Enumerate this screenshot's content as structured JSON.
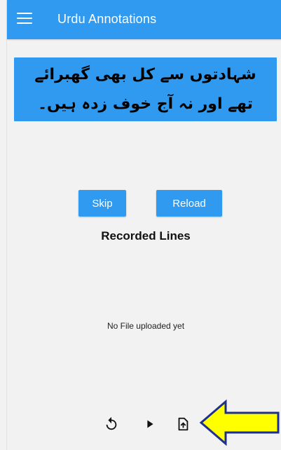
{
  "appbar": {
    "title": "Urdu Annotations",
    "color": "#2f9af0",
    "menu_icon": "menu-icon"
  },
  "annotation": {
    "line1": "شہادتوں سے کل بھی گھبرائے",
    "line2": "تھے اور نہ آج خوف زدہ ہیں۔"
  },
  "buttons": {
    "skip_label": "Skip",
    "reload_label": "Reload"
  },
  "recorded": {
    "title": "Recorded Lines",
    "empty_message": "No File uploaded yet"
  },
  "controls": [
    {
      "name": "replay",
      "icon": "replay-icon"
    },
    {
      "name": "play",
      "icon": "play-icon"
    },
    {
      "name": "upload",
      "icon": "file-upload-icon"
    }
  ],
  "highlight": {
    "icon": "arrow-left-icon",
    "fill": "#ffff00",
    "stroke": "#1f2f8f"
  }
}
